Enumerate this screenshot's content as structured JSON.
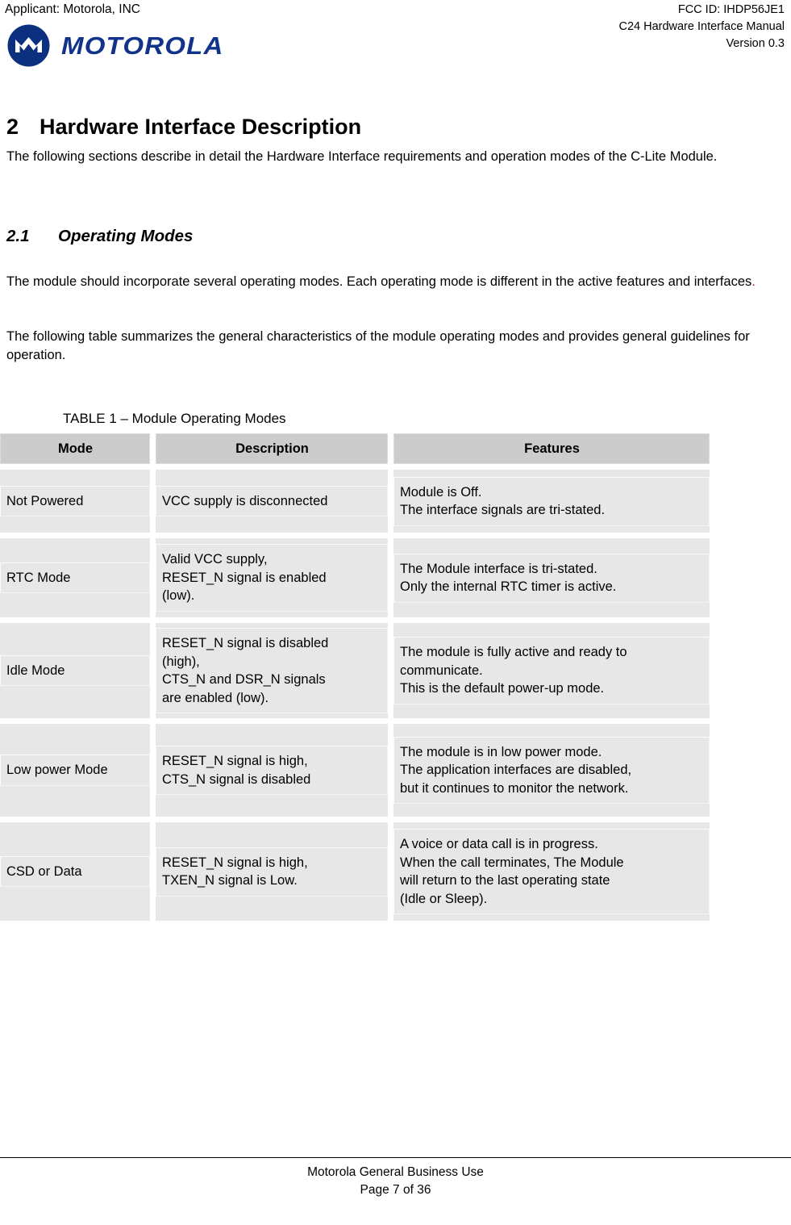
{
  "header": {
    "applicant": "Applicant: Motorola, INC",
    "fcc_id": "FCC ID: IHDP56JE1",
    "manual_title": "C24 Hardware Interface Manual",
    "version": "Version 0.3",
    "logo_wordmark": "MOTOROLA",
    "logo_color": "#11348a"
  },
  "section": {
    "number": "2",
    "title": "Hardware Interface Description",
    "intro": "The following sections describe in detail the Hardware Interface requirements and operation modes of the C-Lite Module."
  },
  "subsection": {
    "number": "2.1",
    "title": "Operating Modes",
    "paragraph1_text": "The module should incorporate several operating modes. Each operating mode is different in the active features and interfaces",
    "paragraph1_mark": ".",
    "paragraph1_mark_color": "#d01818",
    "paragraph2": "The following table summarizes the general characteristics of the module operating modes and provides general guidelines for operation."
  },
  "table": {
    "caption": "TABLE 1 – Module Operating Modes",
    "headers": [
      "Mode",
      "Description",
      "Features"
    ],
    "rows": [
      {
        "mode": "Not Powered",
        "description": [
          "VCC supply is disconnected"
        ],
        "features": [
          "Module is Off.",
          "The interface signals are tri-stated."
        ]
      },
      {
        "mode": "RTC Mode",
        "description": [
          "Valid VCC supply,",
          "RESET_N signal is enabled",
          "(low)."
        ],
        "features": [
          "The Module interface is tri-stated.",
          "Only the internal RTC timer is active."
        ]
      },
      {
        "mode": "Idle Mode",
        "description": [
          "RESET_N signal is disabled",
          "(high),",
          "CTS_N and DSR_N signals",
          "are enabled (low)."
        ],
        "features": [
          "The module is fully active and ready to",
          "communicate.",
          "This is the default power-up mode."
        ]
      },
      {
        "mode": "Low power Mode",
        "description": [
          "RESET_N signal is high,",
          "CTS_N signal is disabled"
        ],
        "features": [
          "The module is in low power mode.",
          "The application interfaces are disabled,",
          "but it continues to monitor the network."
        ]
      },
      {
        "mode": "CSD or Data",
        "description": [
          "RESET_N signal is high,",
          "TXEN_N signal is Low."
        ],
        "features": [
          "A voice or data call is in progress.",
          "When the call terminates, The Module",
          "will return to the last operating state",
          "(Idle or Sleep)."
        ]
      }
    ]
  },
  "footer": {
    "notice": "Motorola General Business Use",
    "page": "Page 7 of 36"
  }
}
